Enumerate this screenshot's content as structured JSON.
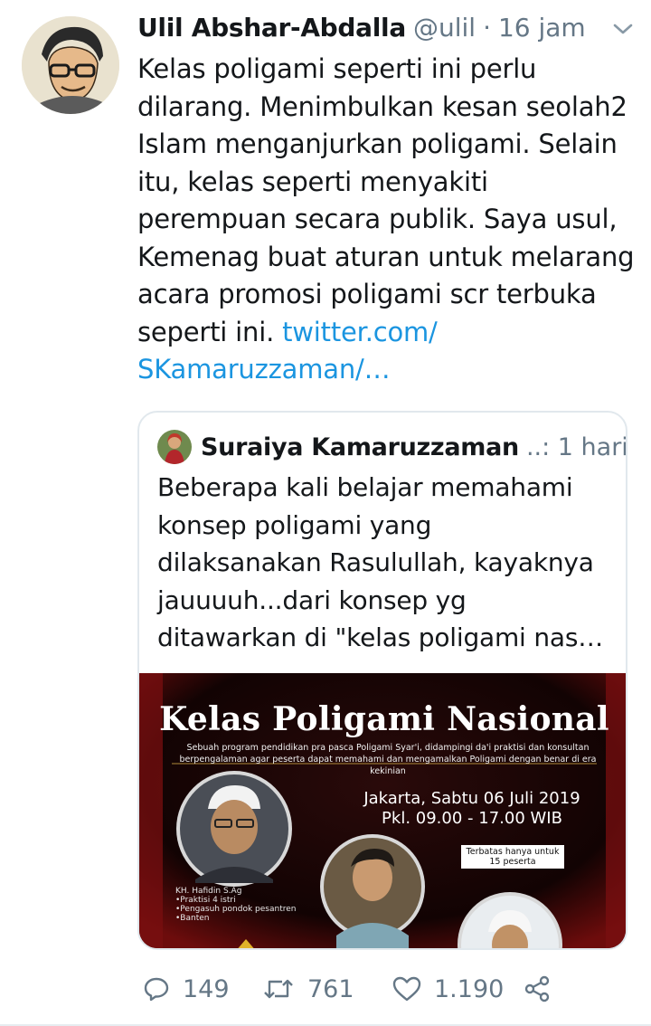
{
  "tweet": {
    "author_name": "Ulil Abshar-Abdalla",
    "handle": "@ulil",
    "separator": "·",
    "time": "16 jam",
    "text": "Kelas poligami seperti ini perlu\ndilarang. Menimbulkan kesan seolah2\nIslam menganjurkan poligami. Selain\nitu, kelas seperti menyakiti\nperempuan secara publik. Saya usul,\nKemenag buat aturan untuk melarang\nacara promosi poligami scr terbuka\nseperti ini. ",
    "link_text": "twitter.com/\nSKamaruzzaman/…",
    "icons": {
      "avatar": "cartoon-avatar",
      "more": "chevron-down-icon"
    }
  },
  "quoted_tweet": {
    "author_name": "Suraiya Kamaruzzaman",
    "meta": "..: 1 hari",
    "text": "Beberapa kali belajar memahami\nkonsep poligami yang\ndilaksanakan Rasulullah, kayaknya\njauuuuh...dari konsep yg\nditawarkan di \"kelas poligami nas…",
    "image": {
      "title": "Kelas Poligami Nasional",
      "subtitle": "Sebuah program pendidikan pra pasca Poligami Syar'i, didampingi da'i praktisi dan konsultan berpengalaman agar peserta dapat memahami dan mengamalkan Poligami dengan benar di era kekinian",
      "date_line1": "Jakarta, Sabtu 06 Juli 2019",
      "date_line2": "Pkl. 09.00 - 17.00 WIB",
      "badge": "Terbatas hanya untuk 15 peserta",
      "speaker": "KH. Hafidin S.Ag\n•Praktisi 4 istri\n•Pengasuh pondok pesantren\n•Banten"
    }
  },
  "actions": {
    "reply_count": "149",
    "retweet_count": "761",
    "like_count": "1.190",
    "icons": [
      "reply-icon",
      "retweet-icon",
      "like-icon",
      "share-icon"
    ]
  },
  "colors": {
    "link": "#1b95e0",
    "meta": "#657786",
    "border": "#e1e8ed"
  }
}
